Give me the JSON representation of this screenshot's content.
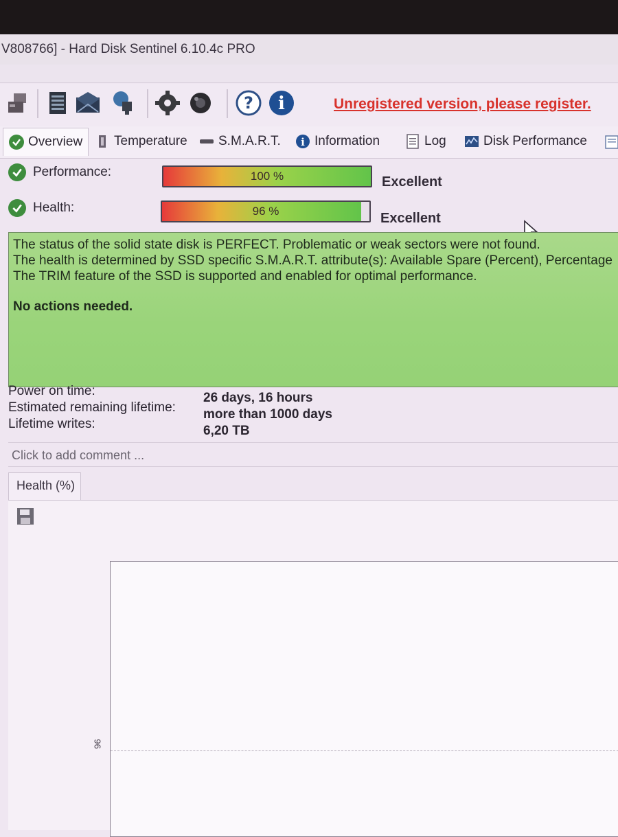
{
  "window": {
    "title": "V808766]  -  Hard Disk Sentinel 6.10.4c PRO"
  },
  "toolbar": {
    "icons": [
      "disk-stack-icon",
      "report-icon",
      "mail-icon",
      "network-icon",
      "settings-gear-icon",
      "surface-test-icon",
      "help-icon",
      "info-icon"
    ],
    "unregistered_text": "Unregistered version, please register."
  },
  "tabs": [
    {
      "label": "Overview",
      "icon": "check-icon"
    },
    {
      "label": "Temperature",
      "icon": "thermometer-icon"
    },
    {
      "label": "S.M.A.R.T.",
      "icon": "smart-icon"
    },
    {
      "label": "Information",
      "icon": "info-icon"
    },
    {
      "label": "Log",
      "icon": "log-icon"
    },
    {
      "label": "Disk Performance",
      "icon": "performance-icon"
    }
  ],
  "performance": {
    "label": "Performance:",
    "percent": 100,
    "percent_text": "100 %",
    "rating": "Excellent"
  },
  "health": {
    "label": "Health:",
    "percent": 96,
    "percent_text": "96 %",
    "rating": "Excellent"
  },
  "status": {
    "line1": "The status of the solid state disk is PERFECT. Problematic or weak sectors were not found.",
    "line2": "The health is determined by SSD specific S.M.A.R.T. attribute(s):  Available Spare (Percent), Percentage",
    "line3": "The TRIM feature of the SSD is supported and enabled for optimal performance.",
    "action": "No actions needed."
  },
  "info": {
    "power_on_label": "Power on time:",
    "power_on_value": "26 days, 16 hours",
    "lifetime_label": "Estimated remaining lifetime:",
    "lifetime_value": "more than 1000 days",
    "writes_label": "Lifetime writes:",
    "writes_value": "6,20 TB"
  },
  "comment": {
    "placeholder": "Click to add comment ..."
  },
  "health_chart": {
    "tab_label": "Health (%)",
    "y_tick": "96"
  },
  "colors": {
    "status_green": "#9ad47a",
    "unregistered_red": "#d8322c",
    "check_green": "#3e8d3e"
  }
}
